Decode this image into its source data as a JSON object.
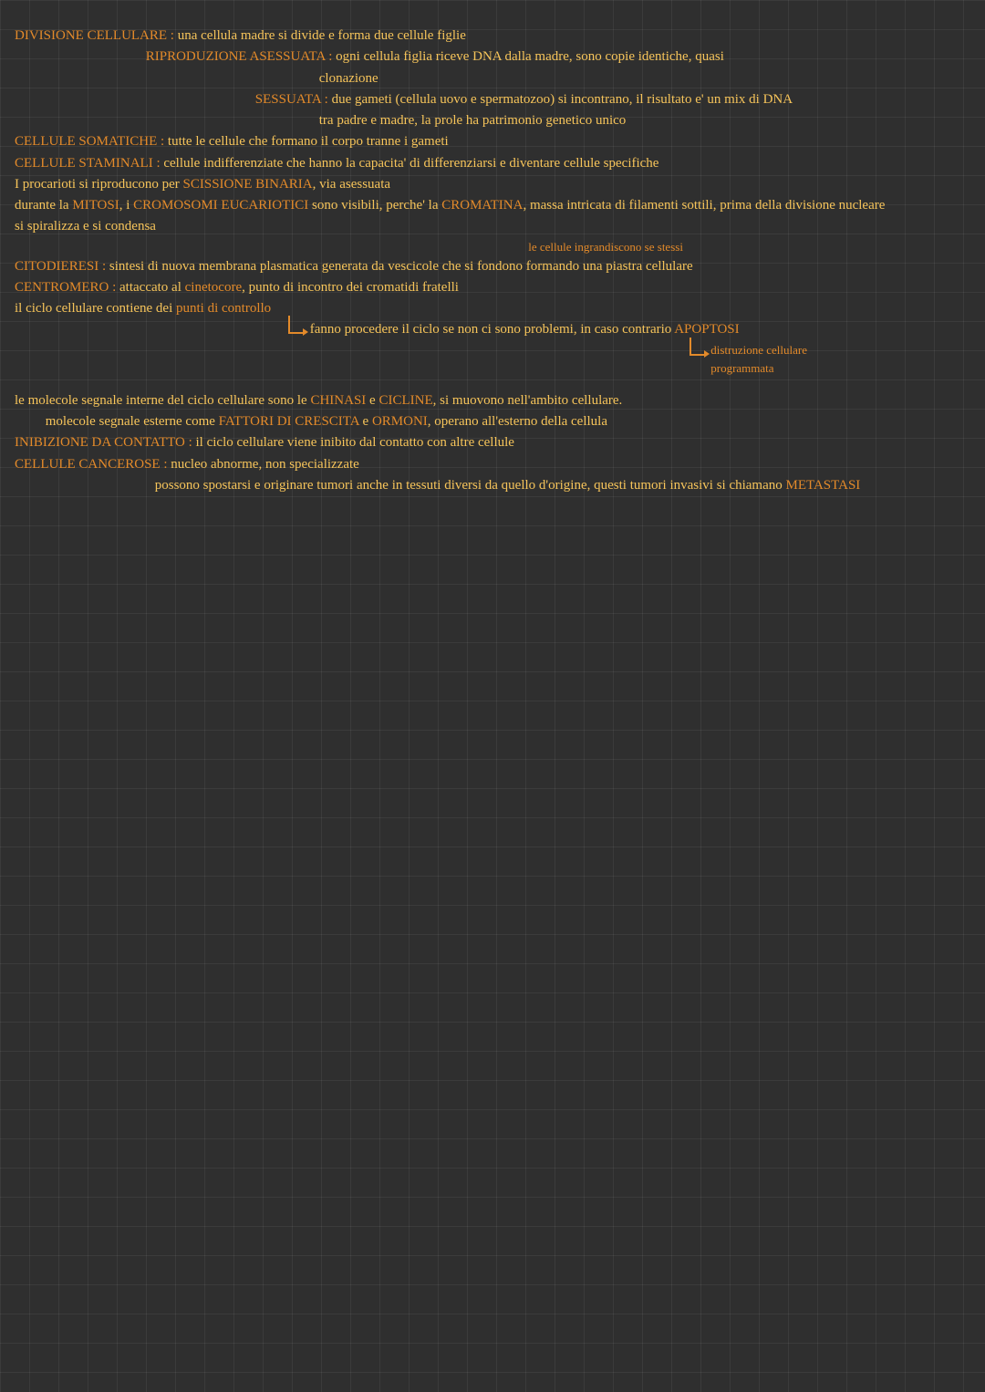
{
  "colors": {
    "orange": "#e38a2a",
    "yellow": "#f6c45a",
    "bg": "#2f2f2f"
  },
  "l1a": "DIVISIONE CELLULARE :",
  "l1b": "una cellula madre si divide e forma due cellule figlie",
  "l2a": "RIPRODUZIONE ASESSUATA :",
  "l2b": "ogni cellula figlia riceve DNA dalla madre, sono copie identiche, quasi",
  "l3": "clonazione",
  "l4a": "SESSUATA :",
  "l4b": "due gameti (cellula uovo e spermatozoo) si incontrano, il risultato e' un mix di DNA",
  "l5": "tra padre e madre, la prole ha patrimonio genetico unico",
  "l6a": "CELLULE SOMATICHE :",
  "l6b": "tutte le cellule che formano il corpo tranne i gameti",
  "l7a": "CELLULE STAMINALI :",
  "l7b": "cellule indifferenziate che hanno la capacita' di differenziarsi e diventare cellule specifiche",
  "l8a": "I procarioti si riproducono per ",
  "l8b": "SCISSIONE BINARIA",
  "l8c": ", via asessuata",
  "l9a": "durante la ",
  "l9b": "MITOSI",
  "l9c": ", i ",
  "l9d": "CROMOSOMI EUCARIOTICI",
  "l9e": " sono visibili, perche' la ",
  "l9f": "CROMATINA",
  "l9g": ", massa intricata di filamenti sottili, prima della divisione nucleare",
  "l10": "si spiralizza e si condensa",
  "l11": "le cellule ingrandiscono se stessi",
  "l12a": "CITODIERESI :",
  "l12b": "sintesi di nuova membrana plasmatica generata da vescicole che si fondono formando una piastra cellulare",
  "l13a": "CENTROMERO :",
  "l13b": "attaccato al ",
  "l13c": "cinetocore",
  "l13d": ", punto di incontro dei cromatidi fratelli",
  "l14a": "il ciclo cellulare contiene dei ",
  "l14b": "punti di controllo",
  "l15a": "fanno procedere il ciclo se non ci sono problemi, in caso contrario ",
  "l15b": "APOPTOSI",
  "l16": "distruzione cellulare",
  "l16b": "programmata",
  "l17a": "le molecole segnale interne del ciclo cellulare sono le ",
  "l17b": "CHINASI",
  "l17c": " e ",
  "l17d": "CICLINE",
  "l17e": ", si muovono nell'ambito cellulare.",
  "l18a": "molecole segnale esterne come ",
  "l18b": "FATTORI DI CRESCITA",
  "l18c": " e ",
  "l18d": "ORMONI",
  "l18e": ", operano all'esterno della cellula",
  "l19a": "INIBIZIONE DA CONTATTO :",
  "l19b": "il ciclo cellulare viene inibito dal contatto con altre cellule",
  "l20a": "CELLULE CANCEROSE :",
  "l20b": "nucleo abnorme, non specializzate",
  "l21a": "possono spostarsi e originare tumori anche in tessuti diversi da quello d'origine, questi tumori invasivi si chiamano ",
  "l21b": "METASTASI"
}
